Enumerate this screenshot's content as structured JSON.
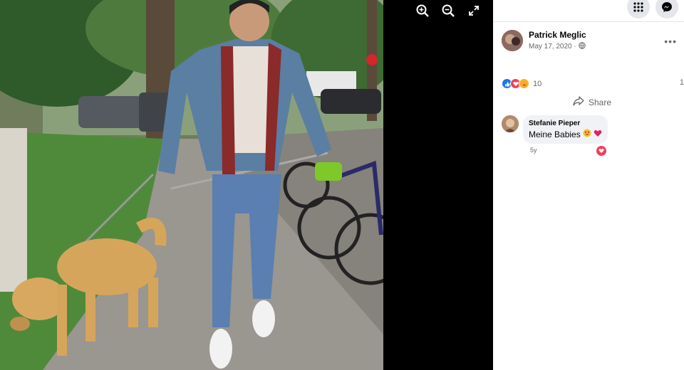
{
  "post": {
    "author": "Patrick Meglic",
    "date": "May 17, 2020 ·",
    "reaction_count": "10",
    "comment_count": "1",
    "share_label": "Share"
  },
  "comment": {
    "author": "Stefanie Pieper",
    "text": "Meine Babies",
    "time": "5y"
  },
  "icons": {
    "zoom_in": "zoom-in-icon",
    "zoom_out": "zoom-out-icon",
    "fullscreen": "fullscreen-icon",
    "menu": "grid-menu-icon",
    "messenger": "messenger-icon",
    "globe": "globe-icon",
    "share": "share-icon",
    "like": "like-reaction-icon",
    "love": "love-reaction-icon",
    "care": "care-reaction-icon"
  },
  "colors": {
    "like": "#1877f2",
    "love": "#f33e58",
    "care": "#f7b125"
  }
}
